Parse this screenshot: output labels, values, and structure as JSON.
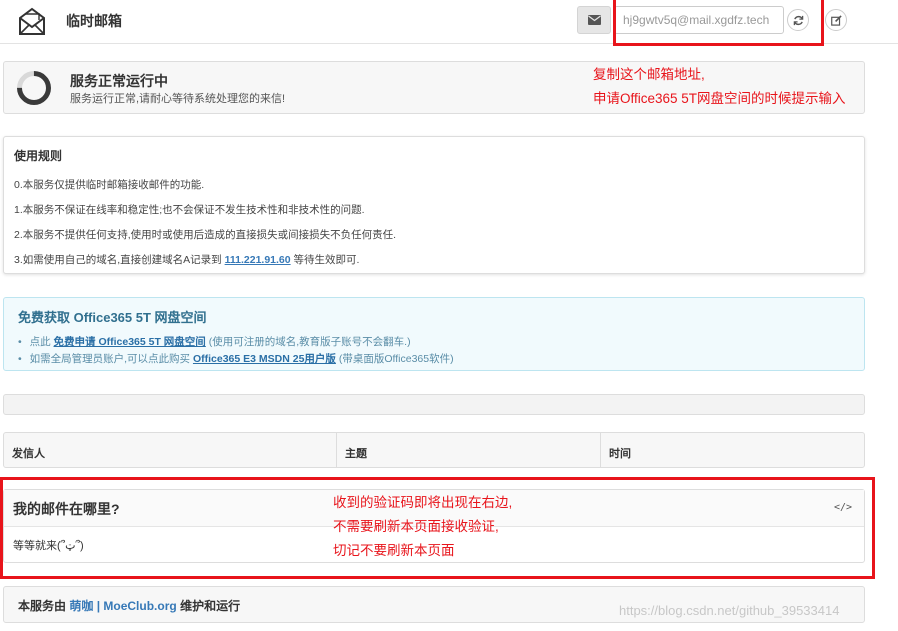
{
  "header": {
    "title": "临时邮箱",
    "email": "hj9gwtv5q@mail.xgdfz.tech"
  },
  "status": {
    "title": "服务正常运行中",
    "desc": "服务运行正常,请耐心等待系统处理您的来信!"
  },
  "annotations": {
    "top_line1": "复制这个邮箱地址,",
    "top_line2": "申请Office365 5T网盘空间的时候提示输入",
    "bottom_line1": "收到的验证码即将出现在右边,",
    "bottom_line2": "不需要刷新本页面接收验证,",
    "bottom_line3": "切记不要刷新本页面"
  },
  "rules": {
    "title": "使用规则",
    "line0": "0.本服务仅提供临时邮箱接收邮件的功能.",
    "line1": "1.本服务不保证在线率和稳定性;也不会保证不发生技术性和非技术性的问题.",
    "line2": "2.本服务不提供任何支持,使用时或使用后造成的直接损失或间接损失不负任何责任.",
    "line3_pre": "3.如需使用自己的域名,直接创建域名A记录到",
    "line3_ip": "111.221.91.60",
    "line3_post": "等待生效即可."
  },
  "office": {
    "title": "免费获取 Office365 5T 网盘空间",
    "bullet": "•",
    "item1_pre": "点此",
    "item1_link": "免费申请 Office365 5T 网盘空间",
    "item1_post": "(使用可注册的域名,教育版子账号不会翻车.)",
    "item2_pre": "如需全局管理员账户,可以点此购买",
    "item2_link": "Office365 E3 MSDN 25用户版",
    "item2_post": "(带桌面版Office365软件)"
  },
  "table": {
    "col_sender": "发信人",
    "col_subject": "主题",
    "col_time": "时间"
  },
  "where": {
    "title": "我的邮件在哪里?",
    "code_icon": "</>",
    "body": "等等就来(՞ټ՞)"
  },
  "footer": {
    "pre": "本服务由",
    "link": "萌咖 | MoeClub.org",
    "post": "维护和运行"
  },
  "watermark": "https://blog.csdn.net/github_39533414",
  "colors": {
    "annotation_red": "#e8141b",
    "link_blue": "#3779b7",
    "info_text": "#31708f"
  }
}
